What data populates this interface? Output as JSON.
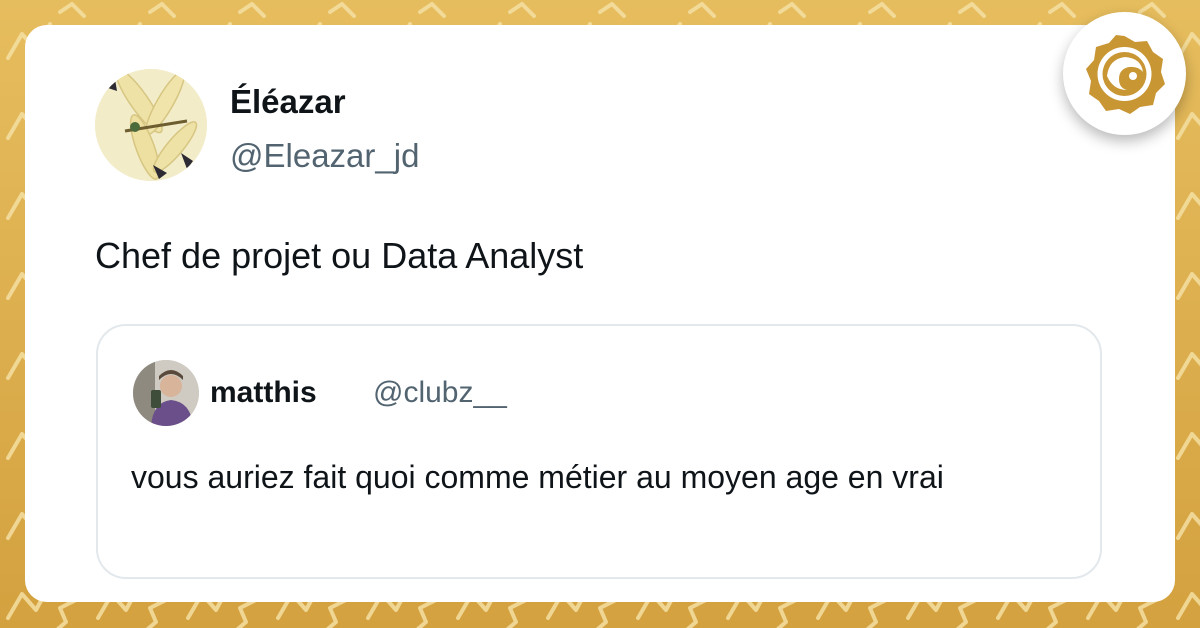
{
  "colors": {
    "background": "#e0b14e",
    "card": "#ffffff",
    "text_primary": "#0f1419",
    "text_secondary": "#536471",
    "quote_border": "#e3e8ec",
    "badge_accent": "#c99634"
  },
  "tweet": {
    "author": {
      "display_name": "Éléazar",
      "handle": "@Eleazar_jd",
      "avatar_icon": "dragonfly-avatar"
    },
    "text": "Chef de projet ou Data Analyst",
    "quoted_tweet": {
      "author": {
        "display_name": "matthis",
        "handle": "@clubz__",
        "avatar_icon": "person-photo-avatar"
      },
      "text": "vous auriez fait quoi comme métier au moyen age en vrai"
    }
  },
  "badge": {
    "icon": "site-logo-icon"
  }
}
